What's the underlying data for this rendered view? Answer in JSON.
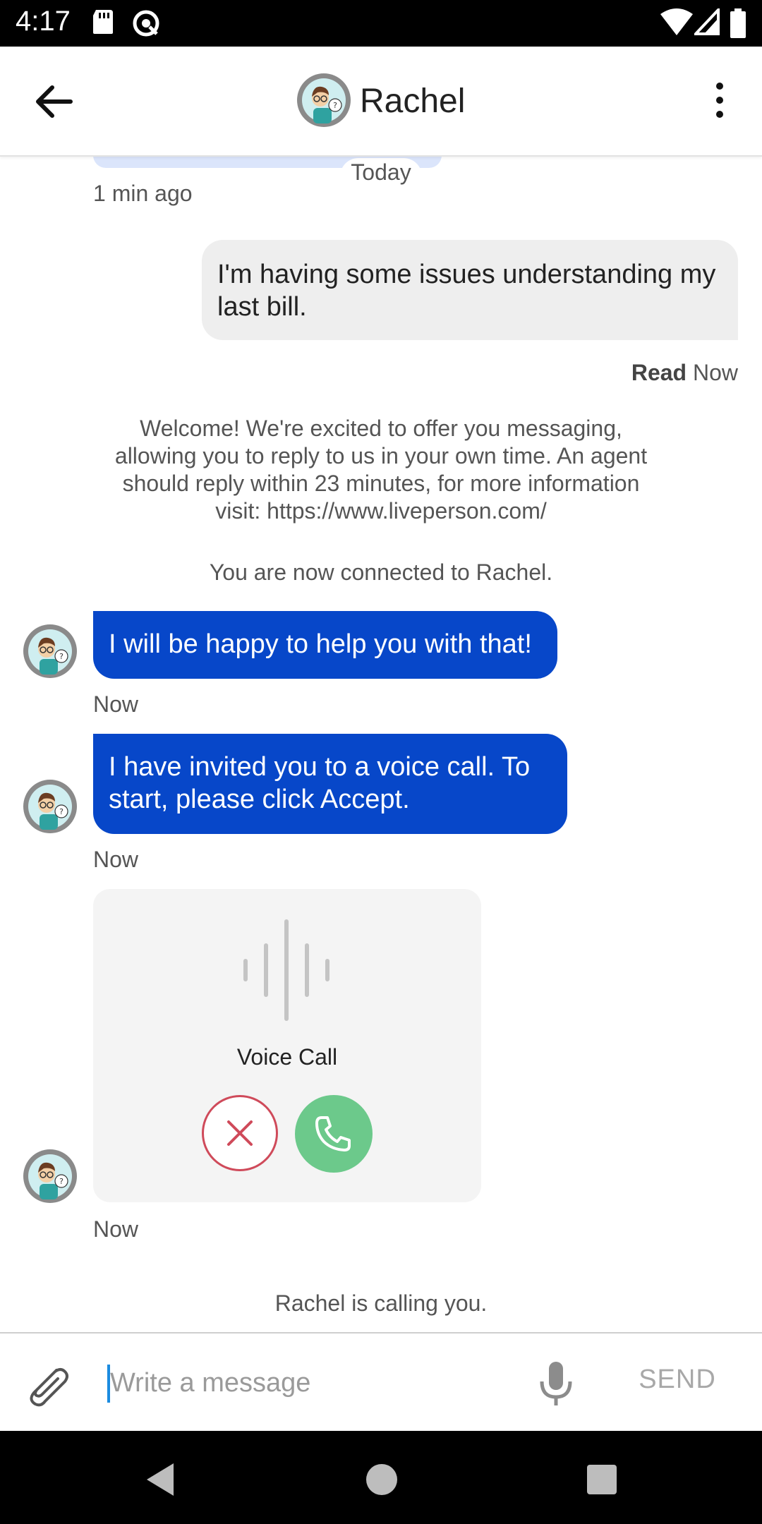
{
  "status_bar": {
    "time": "4:17"
  },
  "header": {
    "title": "Rachel"
  },
  "chat": {
    "date_separator": "Today",
    "earlier_timestamp": "1 min ago",
    "outgoing": {
      "text": "I'm having some issues understanding my last bill.",
      "status_label": "Read",
      "time": "Now"
    },
    "welcome_message": "Welcome! We're excited to offer you messaging, allowing you to reply to us in your own time. An agent should reply within 23 minutes, for more information visit: https://www.liveperson.com/",
    "connected_message": "You are now connected to Rachel.",
    "agent_messages": [
      {
        "text": "I will be happy to help you with that!",
        "time": "Now"
      },
      {
        "text": "I have invited you to a voice call. To start, please click Accept.",
        "time": "Now"
      }
    ],
    "voice_call": {
      "label": "Voice Call",
      "time": "Now"
    },
    "calling_message": "Rachel is calling you."
  },
  "composer": {
    "placeholder": "Write a message",
    "send_label": "SEND"
  },
  "colors": {
    "agent_bubble": "#0747c9",
    "decline": "#cf4a5a",
    "accept": "#6cc98b",
    "cursor": "#1b8be0"
  }
}
